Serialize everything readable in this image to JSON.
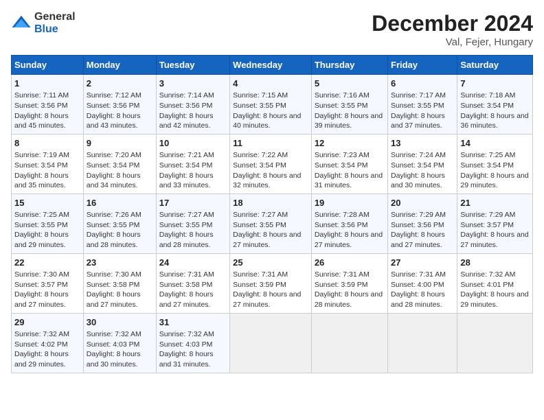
{
  "logo": {
    "general": "General",
    "blue": "Blue"
  },
  "title": "December 2024",
  "subtitle": "Val, Fejer, Hungary",
  "columns": [
    "Sunday",
    "Monday",
    "Tuesday",
    "Wednesday",
    "Thursday",
    "Friday",
    "Saturday"
  ],
  "weeks": [
    [
      {
        "day": "1",
        "sunrise": "Sunrise: 7:11 AM",
        "sunset": "Sunset: 3:56 PM",
        "daylight": "Daylight: 8 hours and 45 minutes."
      },
      {
        "day": "2",
        "sunrise": "Sunrise: 7:12 AM",
        "sunset": "Sunset: 3:56 PM",
        "daylight": "Daylight: 8 hours and 43 minutes."
      },
      {
        "day": "3",
        "sunrise": "Sunrise: 7:14 AM",
        "sunset": "Sunset: 3:56 PM",
        "daylight": "Daylight: 8 hours and 42 minutes."
      },
      {
        "day": "4",
        "sunrise": "Sunrise: 7:15 AM",
        "sunset": "Sunset: 3:55 PM",
        "daylight": "Daylight: 8 hours and 40 minutes."
      },
      {
        "day": "5",
        "sunrise": "Sunrise: 7:16 AM",
        "sunset": "Sunset: 3:55 PM",
        "daylight": "Daylight: 8 hours and 39 minutes."
      },
      {
        "day": "6",
        "sunrise": "Sunrise: 7:17 AM",
        "sunset": "Sunset: 3:55 PM",
        "daylight": "Daylight: 8 hours and 37 minutes."
      },
      {
        "day": "7",
        "sunrise": "Sunrise: 7:18 AM",
        "sunset": "Sunset: 3:54 PM",
        "daylight": "Daylight: 8 hours and 36 minutes."
      }
    ],
    [
      {
        "day": "8",
        "sunrise": "Sunrise: 7:19 AM",
        "sunset": "Sunset: 3:54 PM",
        "daylight": "Daylight: 8 hours and 35 minutes."
      },
      {
        "day": "9",
        "sunrise": "Sunrise: 7:20 AM",
        "sunset": "Sunset: 3:54 PM",
        "daylight": "Daylight: 8 hours and 34 minutes."
      },
      {
        "day": "10",
        "sunrise": "Sunrise: 7:21 AM",
        "sunset": "Sunset: 3:54 PM",
        "daylight": "Daylight: 8 hours and 33 minutes."
      },
      {
        "day": "11",
        "sunrise": "Sunrise: 7:22 AM",
        "sunset": "Sunset: 3:54 PM",
        "daylight": "Daylight: 8 hours and 32 minutes."
      },
      {
        "day": "12",
        "sunrise": "Sunrise: 7:23 AM",
        "sunset": "Sunset: 3:54 PM",
        "daylight": "Daylight: 8 hours and 31 minutes."
      },
      {
        "day": "13",
        "sunrise": "Sunrise: 7:24 AM",
        "sunset": "Sunset: 3:54 PM",
        "daylight": "Daylight: 8 hours and 30 minutes."
      },
      {
        "day": "14",
        "sunrise": "Sunrise: 7:25 AM",
        "sunset": "Sunset: 3:54 PM",
        "daylight": "Daylight: 8 hours and 29 minutes."
      }
    ],
    [
      {
        "day": "15",
        "sunrise": "Sunrise: 7:25 AM",
        "sunset": "Sunset: 3:55 PM",
        "daylight": "Daylight: 8 hours and 29 minutes."
      },
      {
        "day": "16",
        "sunrise": "Sunrise: 7:26 AM",
        "sunset": "Sunset: 3:55 PM",
        "daylight": "Daylight: 8 hours and 28 minutes."
      },
      {
        "day": "17",
        "sunrise": "Sunrise: 7:27 AM",
        "sunset": "Sunset: 3:55 PM",
        "daylight": "Daylight: 8 hours and 28 minutes."
      },
      {
        "day": "18",
        "sunrise": "Sunrise: 7:27 AM",
        "sunset": "Sunset: 3:55 PM",
        "daylight": "Daylight: 8 hours and 27 minutes."
      },
      {
        "day": "19",
        "sunrise": "Sunrise: 7:28 AM",
        "sunset": "Sunset: 3:56 PM",
        "daylight": "Daylight: 8 hours and 27 minutes."
      },
      {
        "day": "20",
        "sunrise": "Sunrise: 7:29 AM",
        "sunset": "Sunset: 3:56 PM",
        "daylight": "Daylight: 8 hours and 27 minutes."
      },
      {
        "day": "21",
        "sunrise": "Sunrise: 7:29 AM",
        "sunset": "Sunset: 3:57 PM",
        "daylight": "Daylight: 8 hours and 27 minutes."
      }
    ],
    [
      {
        "day": "22",
        "sunrise": "Sunrise: 7:30 AM",
        "sunset": "Sunset: 3:57 PM",
        "daylight": "Daylight: 8 hours and 27 minutes."
      },
      {
        "day": "23",
        "sunrise": "Sunrise: 7:30 AM",
        "sunset": "Sunset: 3:58 PM",
        "daylight": "Daylight: 8 hours and 27 minutes."
      },
      {
        "day": "24",
        "sunrise": "Sunrise: 7:31 AM",
        "sunset": "Sunset: 3:58 PM",
        "daylight": "Daylight: 8 hours and 27 minutes."
      },
      {
        "day": "25",
        "sunrise": "Sunrise: 7:31 AM",
        "sunset": "Sunset: 3:59 PM",
        "daylight": "Daylight: 8 hours and 27 minutes."
      },
      {
        "day": "26",
        "sunrise": "Sunrise: 7:31 AM",
        "sunset": "Sunset: 3:59 PM",
        "daylight": "Daylight: 8 hours and 28 minutes."
      },
      {
        "day": "27",
        "sunrise": "Sunrise: 7:31 AM",
        "sunset": "Sunset: 4:00 PM",
        "daylight": "Daylight: 8 hours and 28 minutes."
      },
      {
        "day": "28",
        "sunrise": "Sunrise: 7:32 AM",
        "sunset": "Sunset: 4:01 PM",
        "daylight": "Daylight: 8 hours and 29 minutes."
      }
    ],
    [
      {
        "day": "29",
        "sunrise": "Sunrise: 7:32 AM",
        "sunset": "Sunset: 4:02 PM",
        "daylight": "Daylight: 8 hours and 29 minutes."
      },
      {
        "day": "30",
        "sunrise": "Sunrise: 7:32 AM",
        "sunset": "Sunset: 4:03 PM",
        "daylight": "Daylight: 8 hours and 30 minutes."
      },
      {
        "day": "31",
        "sunrise": "Sunrise: 7:32 AM",
        "sunset": "Sunset: 4:03 PM",
        "daylight": "Daylight: 8 hours and 31 minutes."
      },
      null,
      null,
      null,
      null
    ]
  ]
}
